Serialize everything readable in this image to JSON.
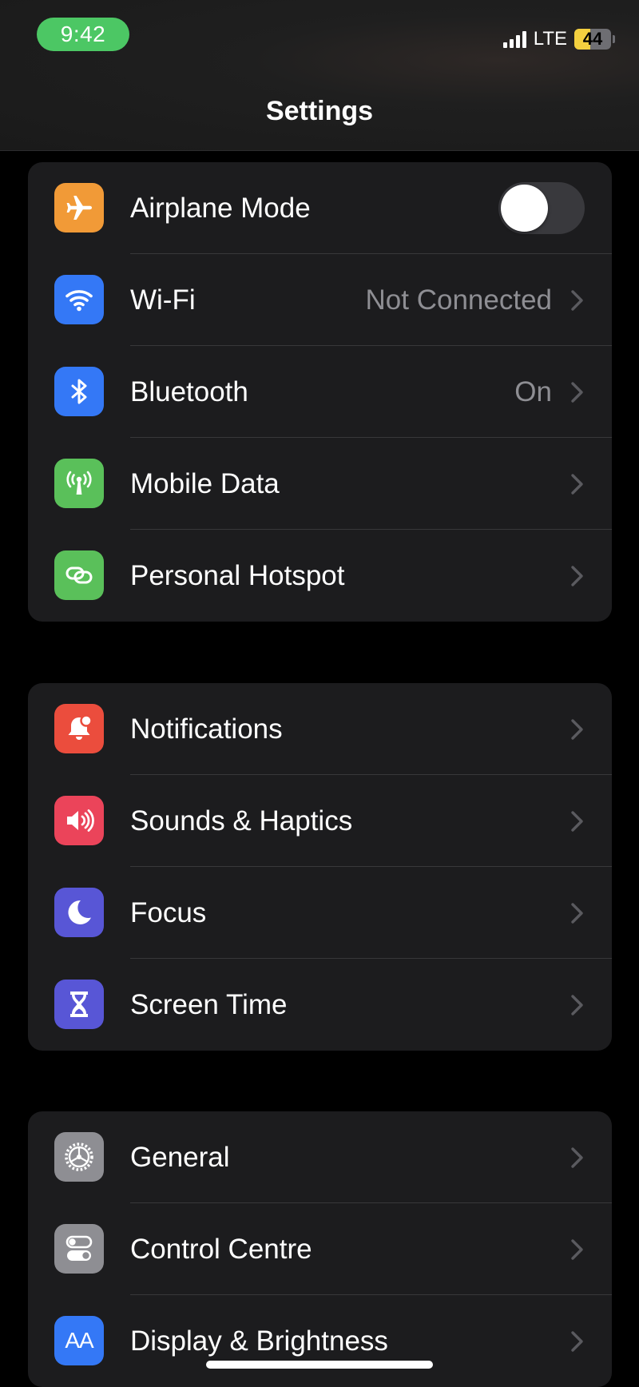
{
  "status_bar": {
    "time": "9:42",
    "network": "LTE",
    "battery_level": "44",
    "battery_fraction": 0.44,
    "time_pill_color": "#4cc764",
    "battery_color": "#f4d03f"
  },
  "header": {
    "title": "Settings"
  },
  "groups": [
    {
      "items": [
        {
          "label": "Airplane Mode",
          "icon": "airplane-icon",
          "icon_color": "#f19a37",
          "control": "toggle",
          "toggle_on": false
        },
        {
          "label": "Wi-Fi",
          "value": "Not Connected",
          "icon": "wifi-icon",
          "icon_color": "#3478f6"
        },
        {
          "label": "Bluetooth",
          "value": "On",
          "icon": "bluetooth-icon",
          "icon_color": "#3478f6"
        },
        {
          "label": "Mobile Data",
          "icon": "antenna-icon",
          "icon_color": "#5ac05a"
        },
        {
          "label": "Personal Hotspot",
          "icon": "hotspot-link-icon",
          "icon_color": "#5ac05a"
        }
      ]
    },
    {
      "items": [
        {
          "label": "Notifications",
          "icon": "notification-bell-icon",
          "icon_color": "#eb4d3d"
        },
        {
          "label": "Sounds & Haptics",
          "icon": "speaker-icon",
          "icon_color": "#eb445a"
        },
        {
          "label": "Focus",
          "icon": "moon-icon",
          "icon_color": "#5856d6"
        },
        {
          "label": "Screen Time",
          "icon": "hourglass-icon",
          "icon_color": "#5856d6"
        }
      ]
    },
    {
      "items": [
        {
          "label": "General",
          "icon": "gear-icon",
          "icon_color": "#8e8e93"
        },
        {
          "label": "Control Centre",
          "icon": "switches-icon",
          "icon_color": "#8e8e93"
        },
        {
          "label": "Display & Brightness",
          "icon": "text-size-icon",
          "icon_color": "#3478f6",
          "icon_text": "AA"
        }
      ]
    }
  ]
}
